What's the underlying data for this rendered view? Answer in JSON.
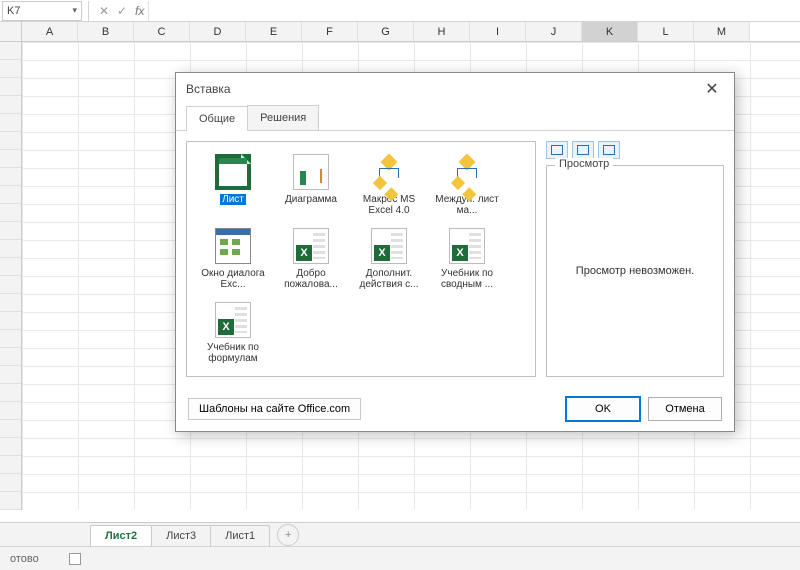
{
  "namebox": {
    "value": "K7"
  },
  "formula_bar": {
    "fx_label": "fx",
    "cancel_glyph": "✕",
    "accept_glyph": "✓"
  },
  "columns": [
    "A",
    "B",
    "C",
    "D",
    "E",
    "F",
    "G",
    "H",
    "I",
    "J",
    "K",
    "L",
    "M"
  ],
  "active_column": "K",
  "rows_visible": 26,
  "sheet_tabs": {
    "tabs": [
      "Лист2",
      "Лист3",
      "Лист1"
    ],
    "active": "Лист2",
    "add_glyph": "+"
  },
  "status": {
    "text": "отово"
  },
  "dialog": {
    "title": "Вставка",
    "close_glyph": "✕",
    "tabs": {
      "items": [
        "Общие",
        "Решения"
      ],
      "active": "Общие"
    },
    "templates": [
      {
        "label": "Лист",
        "icon": "sheet",
        "selected": true
      },
      {
        "label": "Диаграмма",
        "icon": "chart",
        "selected": false
      },
      {
        "label": "Макрос MS Excel 4.0",
        "icon": "macro",
        "selected": false
      },
      {
        "label": "Междун. лист ма...",
        "icon": "macro",
        "selected": false
      },
      {
        "label": "Окно диалога Exc...",
        "icon": "dlg",
        "selected": false
      },
      {
        "label": "Добро пожалова...",
        "icon": "xl",
        "selected": false
      },
      {
        "label": "Дополнит. действия с...",
        "icon": "xl",
        "selected": false
      },
      {
        "label": "Учебник по сводным ...",
        "icon": "xl",
        "selected": false
      },
      {
        "label": "Учебник по формулам",
        "icon": "xl",
        "selected": false
      }
    ],
    "preview": {
      "legend": "Просмотр",
      "message": "Просмотр невозможен."
    },
    "footer": {
      "office_templates": "Шаблоны на сайте Office.com",
      "ok": "OK",
      "cancel": "Отмена"
    }
  }
}
